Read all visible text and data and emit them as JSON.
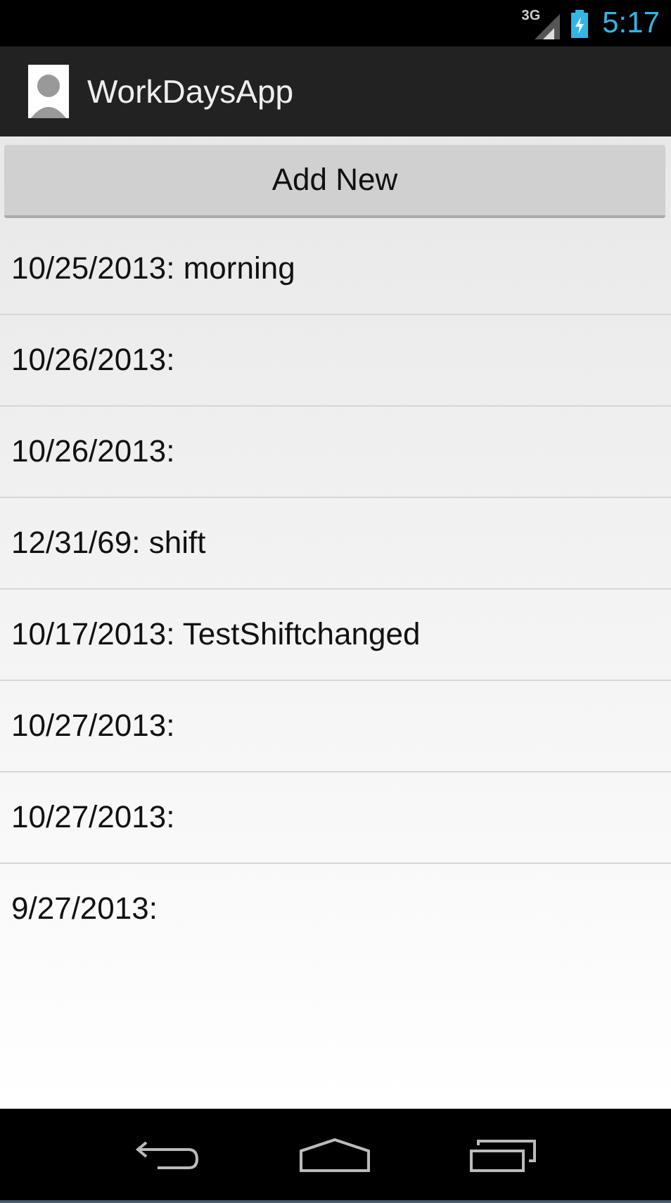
{
  "status_bar": {
    "network": "3G",
    "time": "5:17"
  },
  "action_bar": {
    "title": "WorkDaysApp"
  },
  "add_button": {
    "label": "Add New"
  },
  "entries": [
    {
      "text": "10/25/2013: morning"
    },
    {
      "text": "10/26/2013:"
    },
    {
      "text": "10/26/2013:"
    },
    {
      "text": "12/31/69: shift"
    },
    {
      "text": "10/17/2013: TestShiftchanged"
    },
    {
      "text": "10/27/2013:"
    },
    {
      "text": "10/27/2013:"
    },
    {
      "text": "9/27/2013:"
    }
  ]
}
